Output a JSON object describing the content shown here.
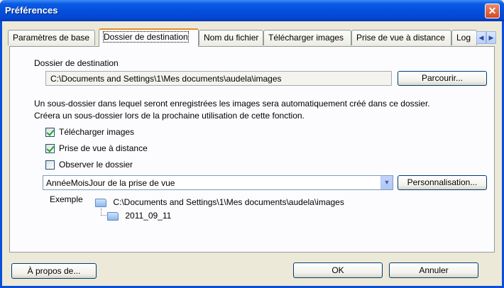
{
  "window": {
    "title": "Préférences"
  },
  "tabs": [
    {
      "label": "Paramètres de base"
    },
    {
      "label": "Dossier de destination"
    },
    {
      "label": "Nom du fichier"
    },
    {
      "label": "Télécharger images"
    },
    {
      "label": "Prise de vue à distance"
    },
    {
      "label": "Log"
    }
  ],
  "destination": {
    "group_label": "Dossier de destination",
    "path": "C:\\Documents and Settings\\1\\Mes documents\\audela\\images",
    "browse_label": "Parcourir..."
  },
  "info": {
    "line1": "Un sous-dossier dans lequel seront enregistrées les images sera automatiquement créé dans ce dossier.",
    "line2": "Créera un sous-dossier lors de la prochaine utilisation de cette fonction."
  },
  "options": {
    "download_images": {
      "label": "Télécharger images",
      "checked": true
    },
    "remote_shooting": {
      "label": "Prise de vue à distance",
      "checked": true
    },
    "watch_folder": {
      "label": "Observer le dossier",
      "checked": false
    }
  },
  "subfolder": {
    "selected": "AnnéeMoisJour de la prise de vue",
    "customize_label": "Personnalisation..."
  },
  "example": {
    "label": "Exemple",
    "root": "C:\\Documents and Settings\\1\\Mes documents\\audela\\images",
    "child": "2011_09_11"
  },
  "footer": {
    "about_label": "À propos de...",
    "ok_label": "OK",
    "cancel_label": "Annuler"
  }
}
